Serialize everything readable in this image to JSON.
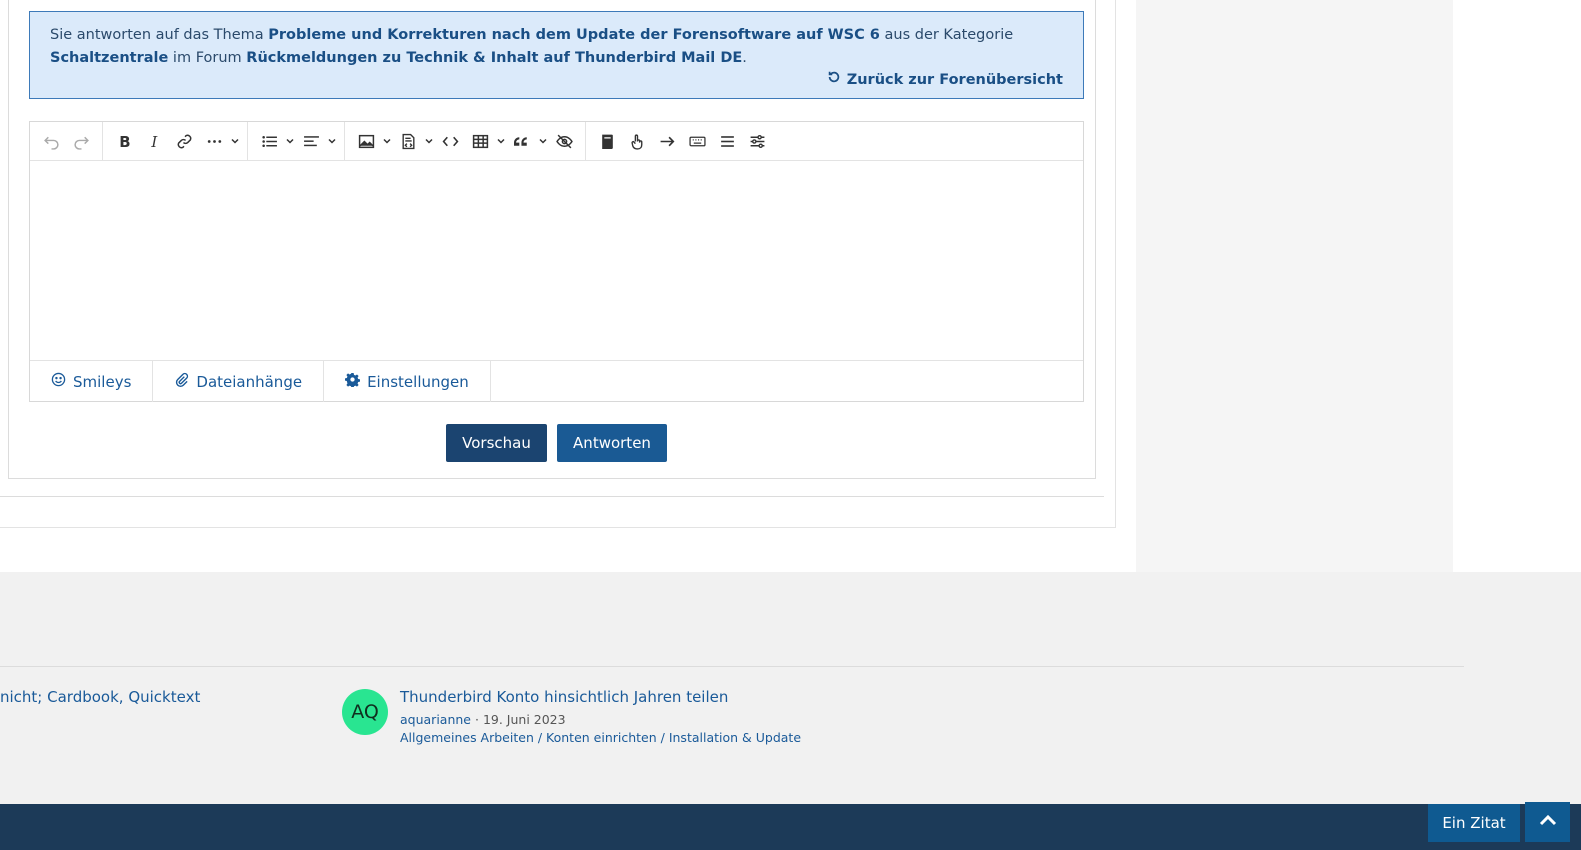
{
  "info": {
    "prefix": "Sie antworten auf das Thema ",
    "thread_title": "Probleme und Korrekturen nach dem Update der Forensoftware auf WSC 6",
    "middle": " aus der Kategorie ",
    "category": "Schaltzentrale",
    "forum_prefix": " im Forum ",
    "forum": "Rückmeldungen zu Technik & Inhalt auf Thunderbird Mail DE",
    "suffix": ".",
    "back_label": "Zurück zur Forenübersicht"
  },
  "toolbar": {
    "icons": [
      "undo-icon",
      "redo-icon",
      "bold-icon",
      "italic-icon",
      "link-icon",
      "more-icon",
      "list-icon",
      "align-icon",
      "image-icon",
      "media-icon",
      "code-icon",
      "table-icon",
      "quote-icon",
      "spoiler-icon",
      "book-icon",
      "pointer-icon",
      "arrow-right-icon",
      "keyboard-icon",
      "menu-icon",
      "settings-sliders-icon"
    ]
  },
  "editor_tabs": {
    "smileys": "Smileys",
    "attachments": "Dateianhänge",
    "settings": "Einstellungen"
  },
  "actions": {
    "preview": "Vorschau",
    "reply": "Antworten"
  },
  "similar": {
    "left_title": "nicht; Cardbook, Quicktext",
    "avatar_initials": "AQ",
    "title": "Thunderbird Konto hinsichtlich Jahren teilen",
    "author": "aquarianne",
    "separator": "·",
    "date": "19. Juni 2023",
    "categories": "Allgemeines Arbeiten / Konten einrichten / Installation & Update"
  },
  "floating": {
    "quote_label": "Ein Zitat"
  },
  "colors": {
    "accent": "#1a5a99",
    "info_bg": "#dbeafa",
    "footer_bar": "#1c3a58",
    "avatar_bg": "#29e591"
  }
}
